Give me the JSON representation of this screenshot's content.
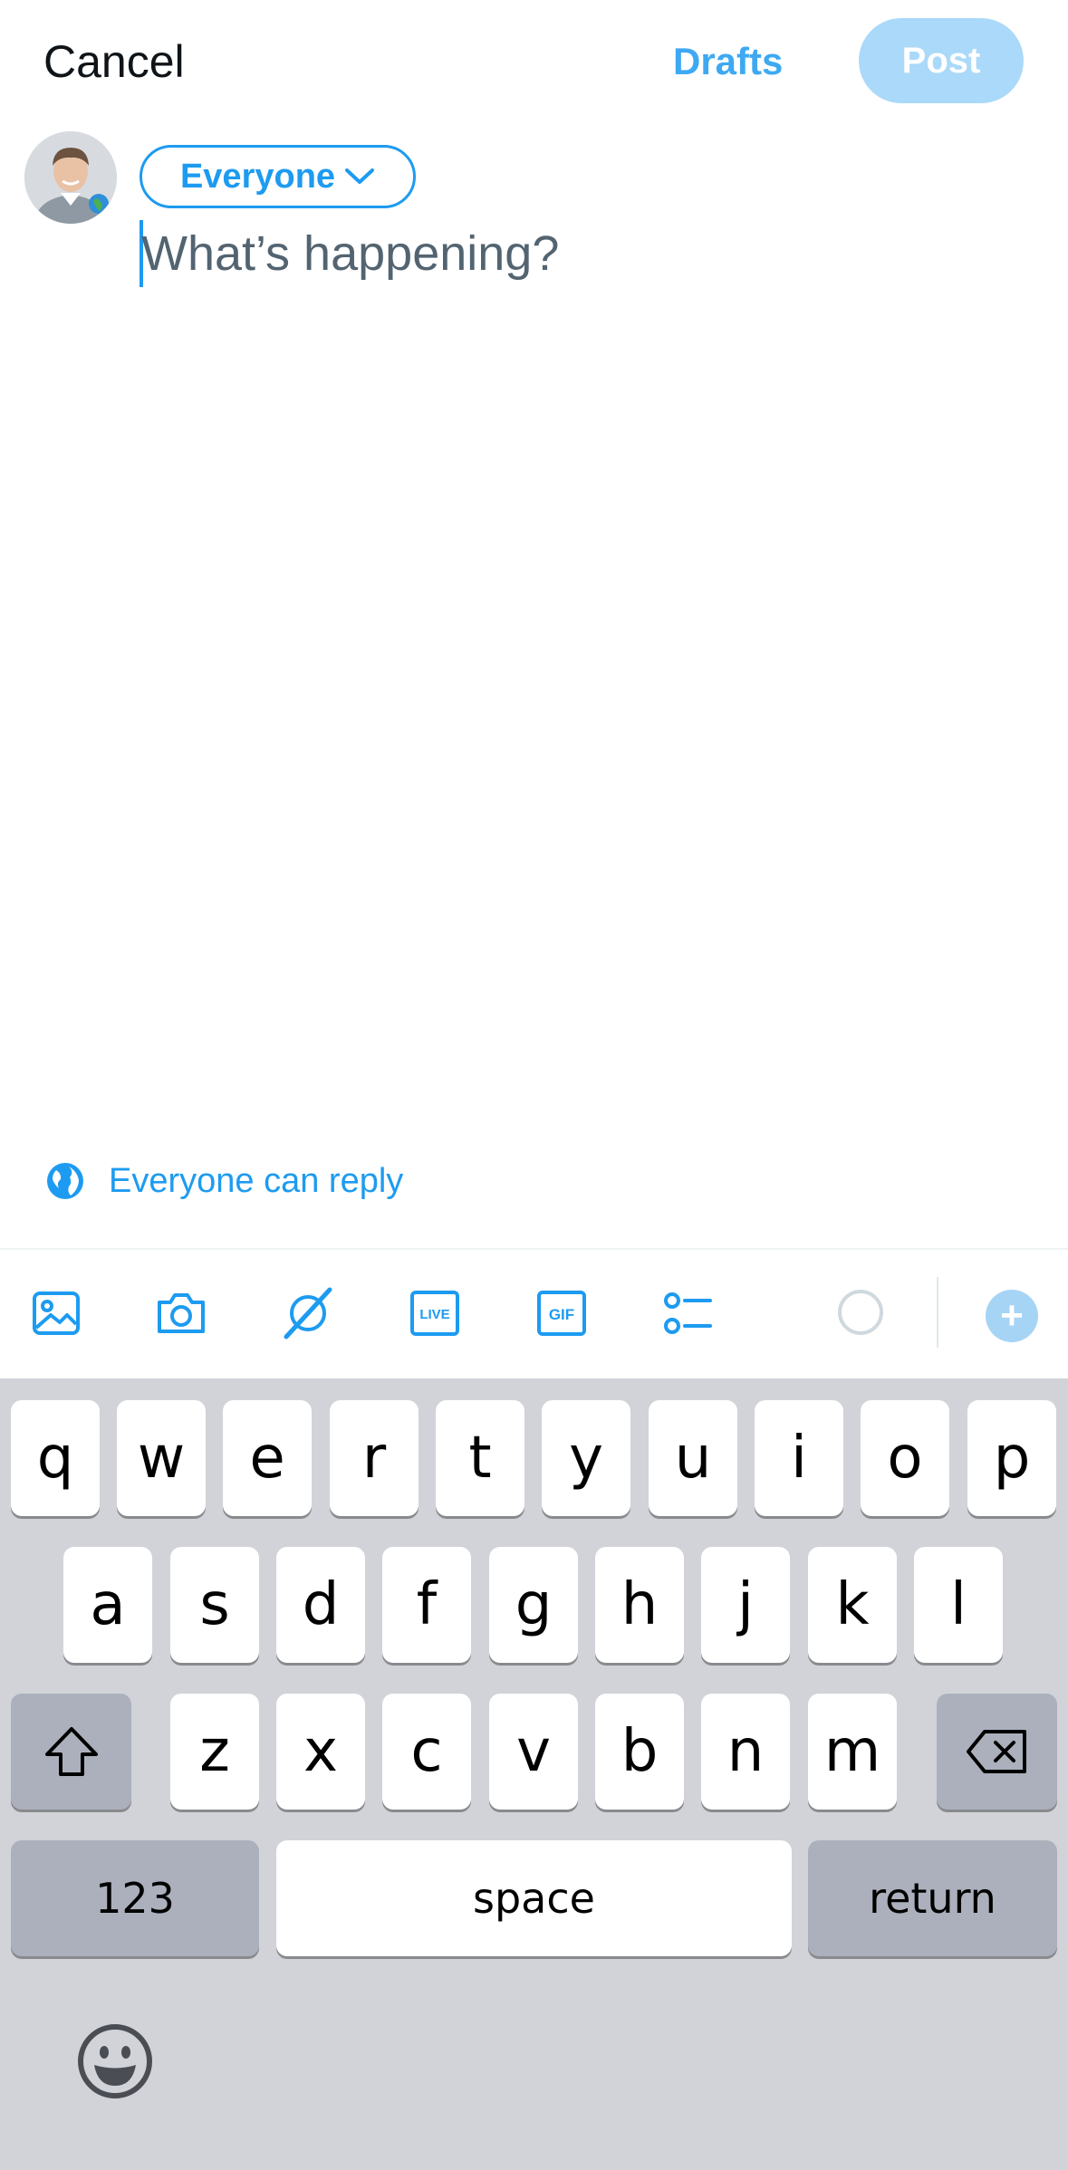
{
  "header": {
    "cancel_label": "Cancel",
    "drafts_label": "Drafts",
    "post_label": "Post"
  },
  "composer": {
    "audience_label": "Everyone",
    "placeholder": "What’s happening?"
  },
  "reply_setting": {
    "label": "Everyone can reply"
  },
  "toolbar": {
    "icons": [
      "image-icon",
      "camera-icon",
      "grok-icon",
      "live-icon",
      "gif-icon",
      "poll-icon",
      "character-counter-ring",
      "add-post-icon"
    ]
  },
  "keyboard": {
    "row1": [
      "q",
      "w",
      "e",
      "r",
      "t",
      "y",
      "u",
      "i",
      "o",
      "p"
    ],
    "row2": [
      "a",
      "s",
      "d",
      "f",
      "g",
      "h",
      "j",
      "k",
      "l"
    ],
    "row3": [
      "z",
      "x",
      "c",
      "v",
      "b",
      "n",
      "m"
    ],
    "numbers_label": "123",
    "space_label": "space",
    "return_label": "return"
  },
  "colors": {
    "accent": "#1d9bf0",
    "post_disabled": "#8ecdf8",
    "keyboard_bg": "#d1d3d9"
  }
}
